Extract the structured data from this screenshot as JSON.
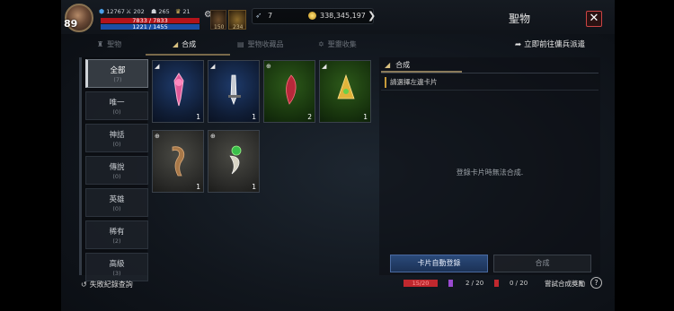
{
  "topbar": {
    "level": "89",
    "stats": [
      {
        "icon": "power-icon",
        "value": "12767"
      },
      {
        "icon": "swords-icon",
        "value": "202"
      },
      {
        "icon": "people-icon",
        "value": "265"
      },
      {
        "icon": "trophy-icon",
        "value": "21"
      }
    ],
    "hp": "7833 / 7833",
    "mp": "1221 / 1455",
    "slot1_count": "150",
    "slot2_count": "234",
    "feather_count": "7",
    "gold": "338,345,197",
    "title": "聖物"
  },
  "tabs": [
    {
      "label": "聖物",
      "icon": "relic-icon",
      "active": false
    },
    {
      "label": "合成",
      "icon": "combine-icon",
      "active": true
    },
    {
      "label": "聖物收藏品",
      "icon": "collection-icon",
      "active": false
    },
    {
      "label": "聖靈收集",
      "icon": "spirit-icon",
      "active": false
    }
  ],
  "dispatch_link": "立即前往傭兵派遣",
  "sidebar": [
    {
      "name": "全部",
      "count": "(7)",
      "active": true
    },
    {
      "name": "唯一",
      "count": "(0)",
      "active": false
    },
    {
      "name": "神話",
      "count": "(0)",
      "active": false
    },
    {
      "name": "傳說",
      "count": "(0)",
      "active": false
    },
    {
      "name": "英雄",
      "count": "(0)",
      "active": false
    },
    {
      "name": "稀有",
      "count": "(2)",
      "active": false
    },
    {
      "name": "高級",
      "count": "(3)",
      "active": false
    }
  ],
  "cards": [
    {
      "name": "pink-pendant",
      "grade": "blue",
      "qty": "1"
    },
    {
      "name": "silver-blade",
      "grade": "blue",
      "qty": "1"
    },
    {
      "name": "red-feather",
      "grade": "green",
      "qty": "2"
    },
    {
      "name": "gold-amulet",
      "grade": "green",
      "qty": "1"
    },
    {
      "name": "wooden-horn",
      "grade": "grey",
      "qty": "1"
    },
    {
      "name": "green-fang",
      "grade": "grey",
      "qty": "1"
    }
  ],
  "right_panel": {
    "tab": "合成",
    "prompt": "請選擇左邊卡片",
    "empty_message": "登錄卡片時無法合成.",
    "auto_button": "卡片自動登錄",
    "combine_button": "合成"
  },
  "bottom": {
    "history": "失敗紀錄查詢",
    "progress1": "15/20",
    "progress2": "2 / 20",
    "progress3": "0 / 20",
    "reward_label": "嘗試合成獎勵",
    "help": "?"
  },
  "colors": {
    "blue_grade": "#1e3a6a",
    "green_grade": "#2d5a1a",
    "grey_grade": "#4a4a44",
    "accent_red": "#c0282e",
    "button_blue": "#2a4a7a"
  }
}
